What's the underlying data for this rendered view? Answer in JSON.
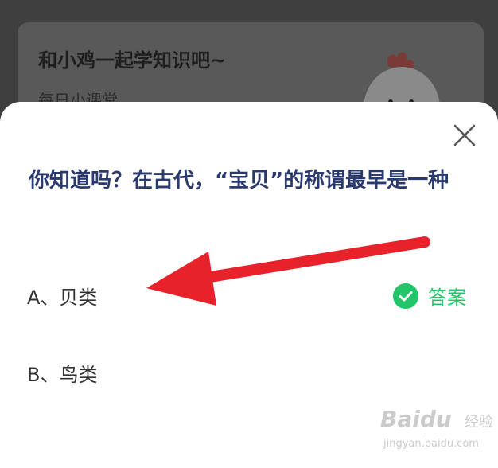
{
  "background_card": {
    "title": "和小鸡一起学知识吧~",
    "subtitle": "每日小课堂"
  },
  "quiz": {
    "question": "你知道吗？在古代，“宝贝”的称谓最早是一种",
    "options": [
      {
        "label": "A、贝类"
      },
      {
        "label": "B、鸟类"
      }
    ],
    "answer_label": "答案",
    "correct_option_index": 0
  },
  "watermark": {
    "brand": "Baidu",
    "suffix": "经验",
    "url": "jingyan.baidu.com"
  },
  "colors": {
    "question_text": "#2b3a6e",
    "answer_green": "#23c56a",
    "annotation_arrow": "#e8222b",
    "overlay_dim": "#3f3f3f",
    "sheet_bg": "#ffffff"
  },
  "icons": {
    "close": "close-icon",
    "answer": "check-circle-icon",
    "mascot": "chick-mascot-icon",
    "annotation": "red-arrow-annotation"
  }
}
